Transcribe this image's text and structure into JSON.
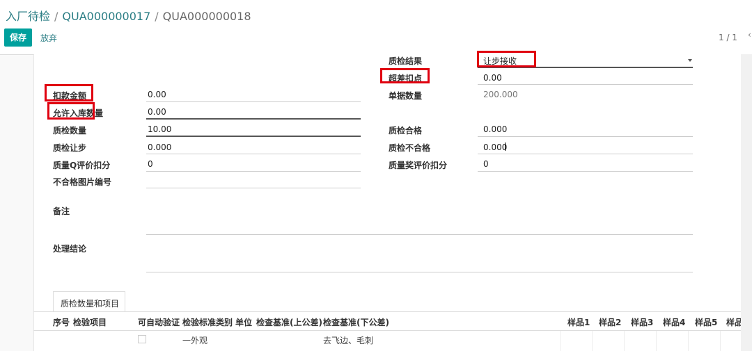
{
  "breadcrumb": {
    "root": "入厂待检",
    "sep1": "/",
    "record1": "QUA000000017",
    "sep2": "/",
    "current": "QUA000000018"
  },
  "control_panel": {
    "save_label": "保存",
    "discard_label": "放弃",
    "pager": "1 / 1"
  },
  "form": {
    "qc_result": {
      "label": "质检结果",
      "value": "让步接收"
    },
    "over_deduct": {
      "label": "超差扣点",
      "value": "0.00"
    },
    "deduct_amount": {
      "label": "扣款金额",
      "value": "0.00"
    },
    "doc_qty": {
      "label": "单据数量",
      "value": "200.000"
    },
    "allowed_in_qty": {
      "label": "允许入库数量",
      "value": "0.00"
    },
    "qc_qty": {
      "label": "质检数量",
      "value": "10.00"
    },
    "qc_pass": {
      "label": "质检合格",
      "value": "0.000"
    },
    "qc_concession": {
      "label": "质检让步",
      "value": "0.000"
    },
    "qc_fail": {
      "label": "质检不合格",
      "value": "0.000"
    },
    "quality_q_deduct": {
      "label": "质量Q评价扣分",
      "value": "0"
    },
    "quality_award_deduct": {
      "label": "质量奖评价扣分",
      "value": "0"
    },
    "fail_image_no": {
      "label": "不合格图片编号",
      "value": ""
    },
    "remark": {
      "label": "备注",
      "value": ""
    },
    "conclusion": {
      "label": "处理结论",
      "value": ""
    }
  },
  "notebook": {
    "tab_label": "质检数量和项目",
    "columns": {
      "seq": "序号",
      "item": "检验项目",
      "auto": "可自动验证",
      "std_type": "检验标准类别",
      "unit": "单位",
      "upper": "检查基准(上公差)",
      "lower": "检查基准(下公差)",
      "s1": "样品1",
      "s2": "样品2",
      "s3": "样品3",
      "s4": "样品4",
      "s5": "样品5",
      "s6": "样品"
    },
    "rows": [
      {
        "std_type": "一外观",
        "lower": "去飞边、毛刺"
      }
    ]
  },
  "colors": {
    "accent": "#00a09d",
    "link": "#2a7d84",
    "highlight": "#e0000f"
  }
}
